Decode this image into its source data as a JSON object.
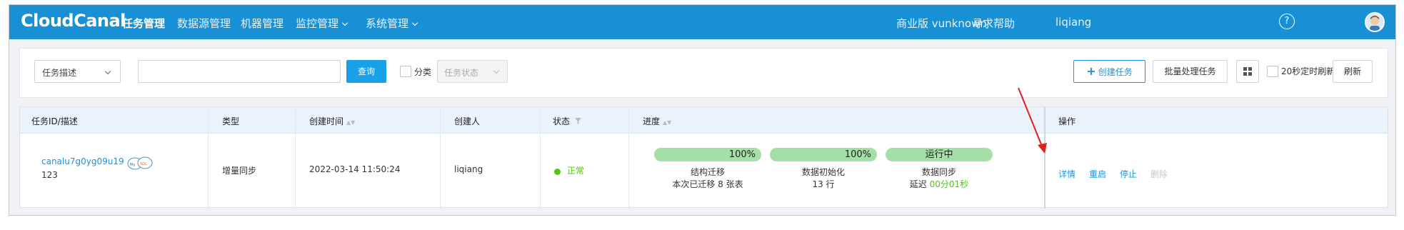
{
  "app": {
    "logo": "CloudCanal",
    "nav": [
      {
        "label": "任务管理",
        "active": true
      },
      {
        "label": "数据源管理"
      },
      {
        "label": "机器管理"
      },
      {
        "label": "监控管理",
        "dropdown": true
      },
      {
        "label": "系统管理",
        "dropdown": true
      }
    ],
    "edition": "商业版 vunknown",
    "help_label": "寻求帮助",
    "help_icon": "?",
    "username": "liqiang",
    "colors": {
      "nav_bg": "#1890d6",
      "accent": "#1a94dc",
      "success": "#52c41a",
      "progress_fill": "#a3dfa6",
      "arrow": "#e02020"
    }
  },
  "filters": {
    "type_select": "任务描述",
    "search_value": "",
    "query_button": "查询",
    "category_label": "分类",
    "status_placeholder": "任务状态",
    "create_button": "创建任务",
    "batch_button": "批量处理任务",
    "auto_refresh_label": "20秒定时刷新",
    "refresh_button": "刷新"
  },
  "table": {
    "headers": {
      "id": "任务ID/描述",
      "type": "类型",
      "created": "创建时间",
      "creator": "创建人",
      "status": "状态",
      "progress": "进度",
      "ops": "操作"
    },
    "row": {
      "task_id": "canalu7g0yg09u19",
      "description": "123",
      "type": "增量同步",
      "created": "2022-03-14 11:50:24",
      "creator": "liqiang",
      "status": "正常",
      "progress": [
        {
          "pill": "100%",
          "stage": "结构迁移",
          "detail": "本次已迁移 8 张表"
        },
        {
          "pill": "100%",
          "stage": "数据初始化",
          "detail": "13 行"
        },
        {
          "pill": "运行中",
          "stage": "数据同步",
          "detail_prefix": "延迟",
          "detail_value": "00分01秒"
        }
      ],
      "ops": [
        "详情",
        "重启",
        "停止",
        "删除"
      ]
    }
  }
}
